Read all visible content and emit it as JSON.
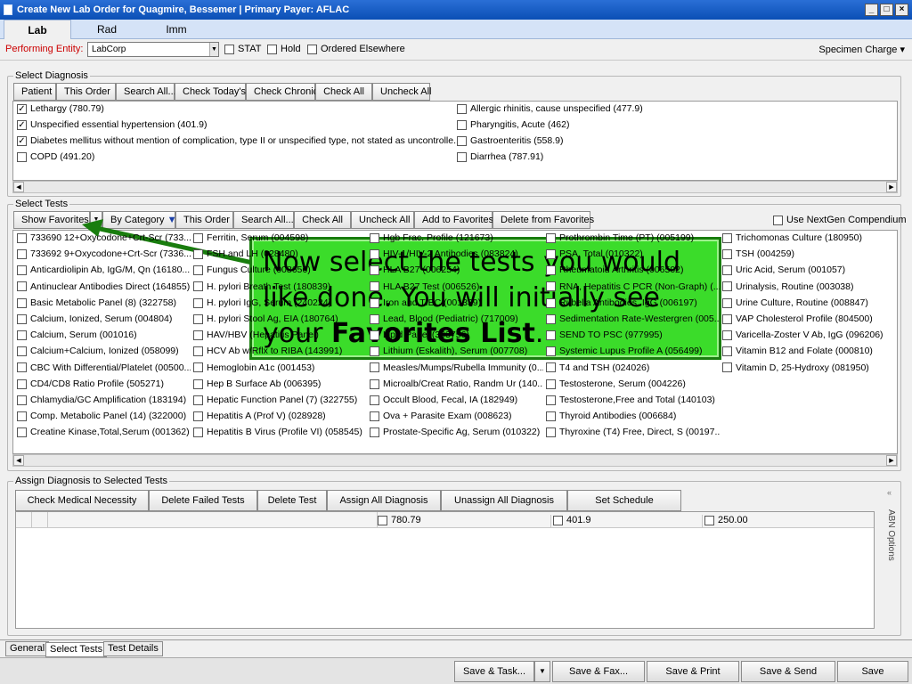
{
  "window": {
    "title": "Create New Lab Order for Quagmire, Bessemer | Primary Payer: AFLAC"
  },
  "tabs": [
    "Lab",
    "Rad",
    "Imm"
  ],
  "performing": {
    "label": "Performing Entity:",
    "value": "LabCorp",
    "stat": "STAT",
    "hold": "Hold",
    "ordered_elsewhere": "Ordered Elsewhere",
    "specimen": "Specimen Charge"
  },
  "diagnosis": {
    "group_label": "Select Diagnosis",
    "buttons": [
      "Patient",
      "This Order",
      "Search All...",
      "Check Today's",
      "Check Chronic",
      "Check All",
      "Uncheck All"
    ],
    "items_left": [
      {
        "label": "Lethargy (780.79)",
        "checked": true
      },
      {
        "label": "Unspecified essential hypertension (401.9)",
        "checked": true
      },
      {
        "label": "Diabetes mellitus without mention of complication, type II or unspecified type, not stated as uncontrolle...",
        "checked": true
      },
      {
        "label": "COPD (491.20)",
        "checked": false
      }
    ],
    "items_right": [
      {
        "label": "Allergic rhinitis, cause unspecified (477.9)",
        "checked": false
      },
      {
        "label": "Pharyngitis, Acute (462)",
        "checked": false
      },
      {
        "label": "Gastroenteritis (558.9)",
        "checked": false
      },
      {
        "label": "Diarrhea (787.91)",
        "checked": false
      }
    ]
  },
  "tests": {
    "group_label": "Select Tests",
    "buttons": [
      "Show Favorites",
      "By Category",
      "This Order",
      "Search All...",
      "Check All",
      "Uncheck All",
      "Add to Favorites",
      "Delete from Favorites"
    ],
    "nextgen": "Use NextGen Compendium",
    "columns": [
      [
        "733690 12+Oxycodone+Crt-Scr (733...",
        "733692 9+Oxycodone+Crt-Scr (7336...",
        "Anticardiolipin Ab, IgG/M, Qn (16180...",
        "Antinuclear Antibodies Direct (164855)",
        "Basic Metabolic Panel (8) (322758)",
        "Calcium, Ionized, Serum (004804)",
        "Calcium, Serum (001016)",
        "Calcium+Calcium, Ionized (058099)",
        "CBC With Differential/Platelet (00500...",
        "CD4/CD8 Ratio Profile (505271)",
        "Chlamydia/GC Amplification (183194)",
        "Comp. Metabolic Panel (14) (322000)",
        "Creatine Kinase,Total,Serum (001362)"
      ],
      [
        "Ferritin, Serum (004598)",
        "FSH and LH (028480)",
        "Fungus Culture (008656)",
        "H. pylori Breath Test (180839)",
        "H. pylori IgG, Serum (240224)",
        "H. pylori Stool Ag, EIA (180764)",
        "HAV/HBV (Hepatitis Panel)",
        "HCV Ab w/Rflx to RIBA (143991)",
        "Hemoglobin A1c (001453)",
        "Hep B Surface Ab (006395)",
        "Hepatic Function Panel (7) (322755)",
        "Hepatitis A (Prof V) (028928)",
        "Hepatitis B Virus (Profile VI) (058545)"
      ],
      [
        "Hgb Frac. Profile (121673)",
        "HIV-1/HIV-2 Antibodies (083824)",
        "HLA B27 (006254)",
        "HLA B27 Test (006526)",
        "Iron and TIBC (001339)",
        "Lead, Blood (Pediatric) (717009)",
        "Lipid Panel (303756)",
        "Lithium (Eskalith), Serum (007708)",
        "Measles/Mumps/Rubella Immunity (0...",
        "Microalb/Creat Ratio, Randm Ur (140...",
        "Occult Blood, Fecal, IA (182949)",
        "Ova + Parasite Exam (008623)",
        "Prostate-Specific Ag, Serum (010322)"
      ],
      [
        "Prothrombin Time (PT) (005199)",
        "PSA, Total (010322)",
        "Rheumatoid Arthritis (006502)",
        "RNA, Hepatitis C PCR (Non-Graph) (...",
        "Rubella Antibodies, IgG (006197)",
        "Sedimentation Rate-Westergren (005...",
        "SEND TO PSC (977995)",
        "Systemic Lupus Profile A (056499)",
        "T4 and TSH (024026)",
        "Testosterone, Serum (004226)",
        "Testosterone,Free and Total (140103)",
        "Thyroid Antibodies (006684)",
        "Thyroxine (T4) Free, Direct, S (00197..."
      ],
      [
        "Trichomonas Culture (180950)",
        "TSH (004259)",
        "Uric Acid, Serum (001057)",
        "Urinalysis, Routine (003038)",
        "Urine Culture, Routine (008847)",
        "VAP Cholesterol Profile (804500)",
        "Varicella-Zoster V Ab, IgG (096206)",
        "Vitamin B12 and Folate (000810)",
        "Vitamin D, 25-Hydroxy (081950)"
      ]
    ]
  },
  "assign": {
    "group_label": "Assign Diagnosis to Selected Tests",
    "buttons": [
      "Check Medical Necessity",
      "Delete Failed Tests",
      "Delete Test",
      "Assign All Diagnosis",
      "Unassign All Diagnosis",
      "Set Schedule"
    ],
    "columns": [
      "780.79",
      "401.9",
      "250.00"
    ],
    "abn": "ABN Options"
  },
  "callout": {
    "line1": "Now select the tests you would",
    "line2": "like done.  You will initially see",
    "line3a": "your ",
    "line3b": "Favorites List",
    "line3c": "."
  },
  "bottom_tabs": [
    "General",
    "Select Tests",
    "Test Details"
  ],
  "footer_buttons": [
    "Save & Task...",
    "Save & Fax...",
    "Save & Print",
    "Save & Send",
    "Save"
  ],
  "colors": {
    "callout_bg": "#3bdc2a",
    "arrow": "#197d0e",
    "titlebar": "#0b4fb5",
    "perf_label": "#cc0000"
  }
}
